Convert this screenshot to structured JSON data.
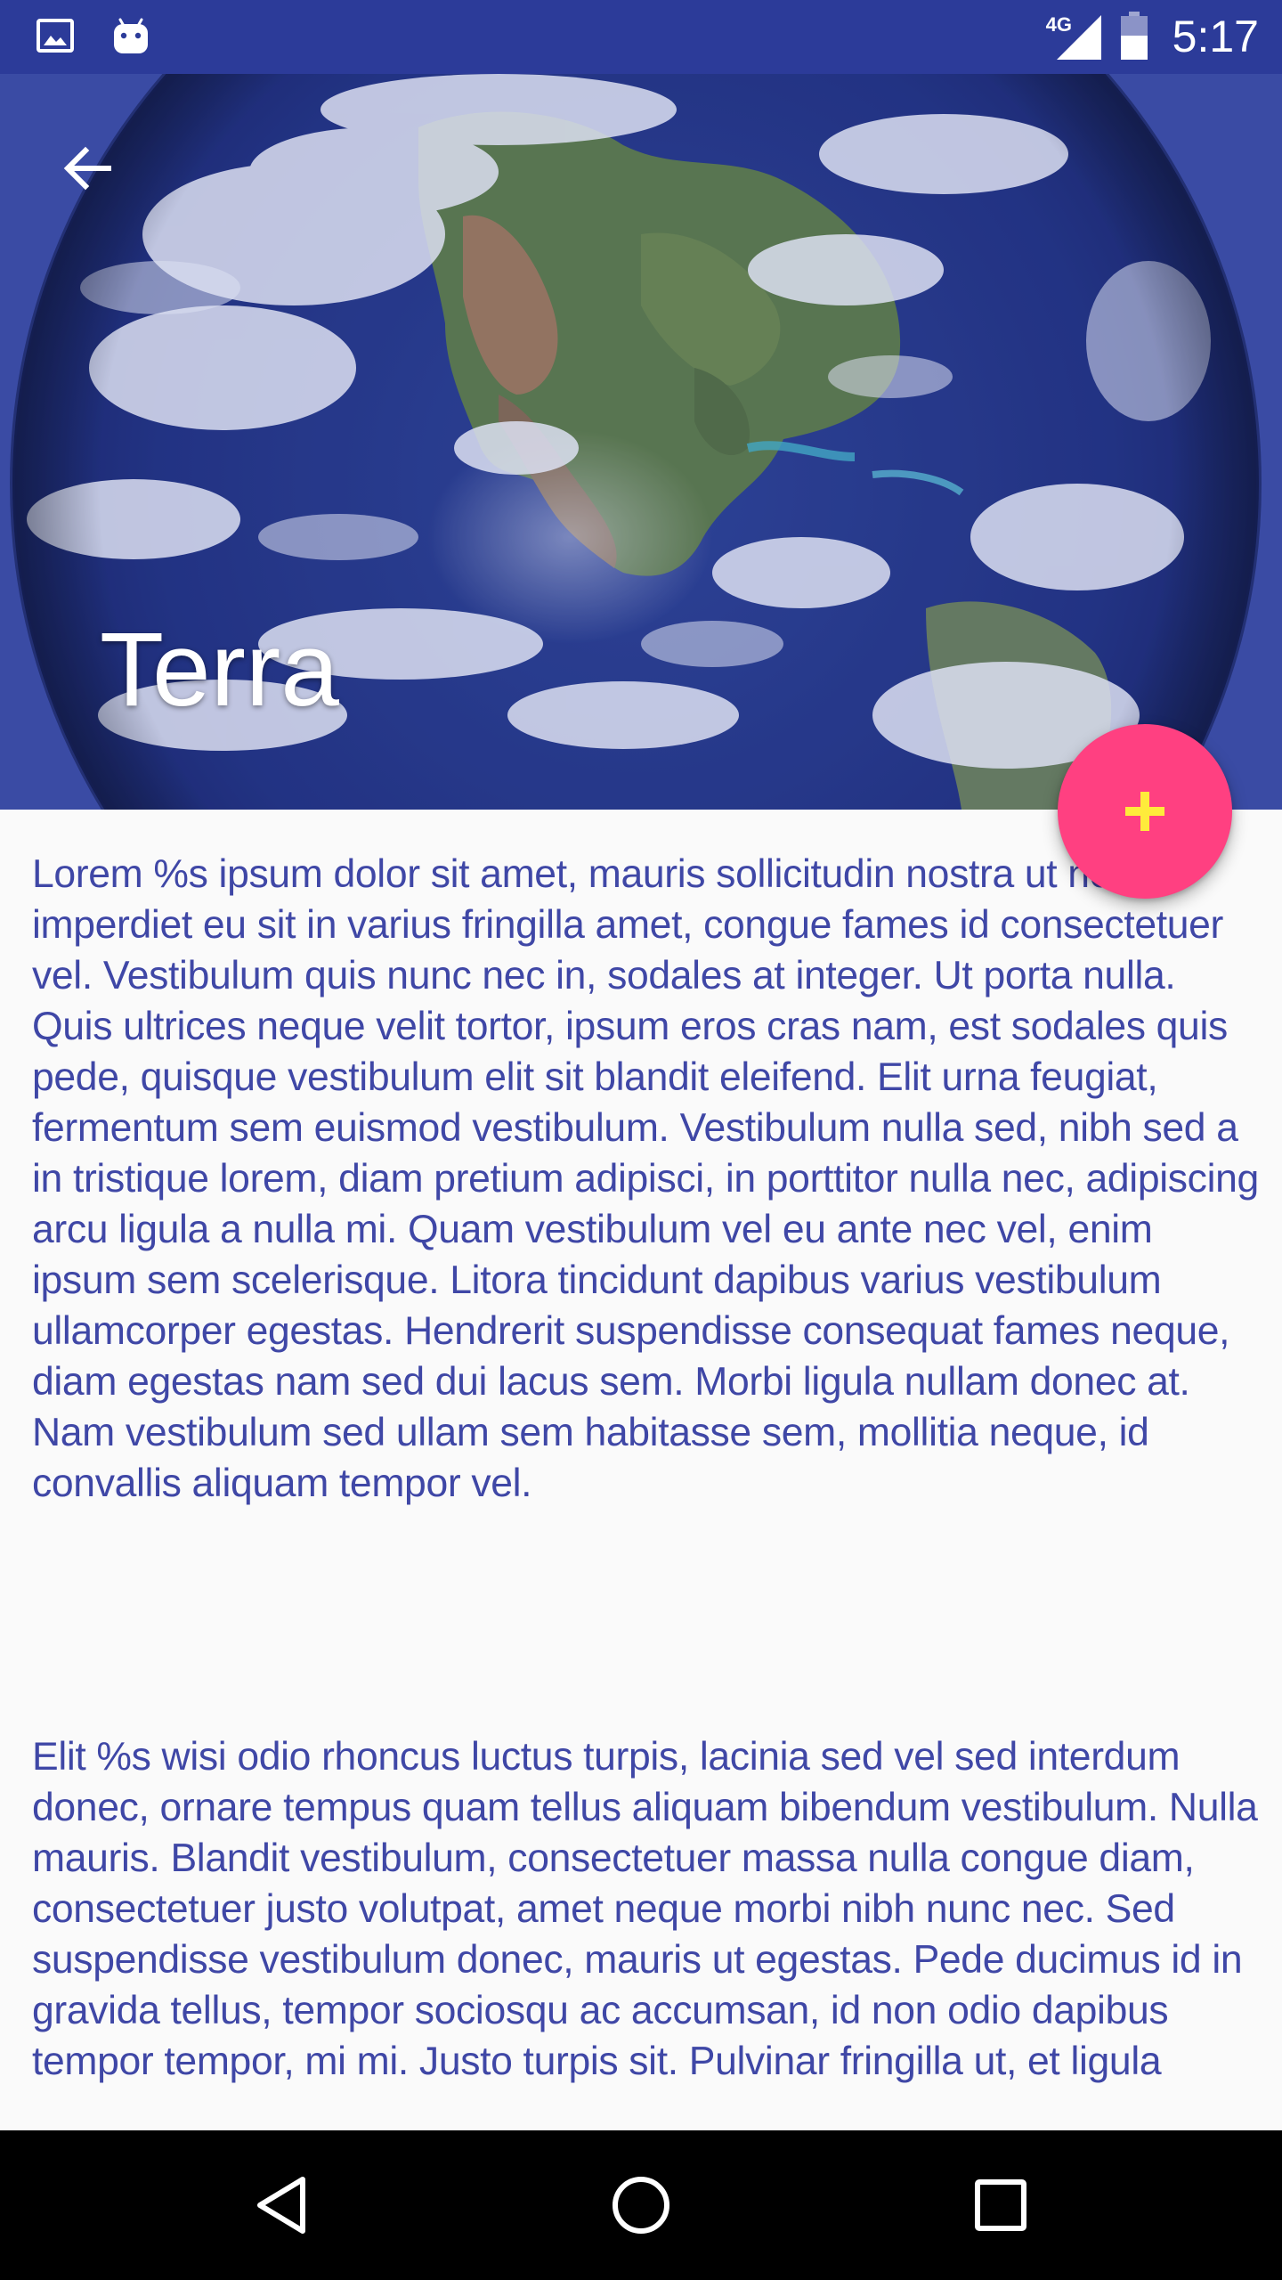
{
  "status_bar": {
    "network_type": "4G",
    "time": "5:17",
    "icons": [
      "gallery-icon",
      "android-icon",
      "signal-icon",
      "battery-icon"
    ]
  },
  "header": {
    "title": "Terra",
    "back_icon": "arrow-back-icon",
    "image": "earth-globe"
  },
  "fab": {
    "icon": "plus-icon",
    "background_color": "#ff4081",
    "icon_color": "#ffeb3b"
  },
  "content": {
    "paragraphs": [
      "Lorem %s ipsum dolor sit amet, mauris sollicitudin nostra ut nec, imperdiet eu sit in varius fringilla amet, congue fames id consectetuer vel. Vestibulum quis nunc nec in, sodales at integer. Ut porta nulla. Quis ultrices neque velit tortor, ipsum eros cras nam, est sodales quis pede, quisque vestibulum elit sit blandit eleifend. Elit urna feugiat, fermentum sem euismod vestibulum. Vestibulum nulla sed, nibh sed a in tristique lorem, diam pretium adipisci, in porttitor nulla nec, adipiscing arcu ligula a nulla mi. Quam vestibulum vel eu ante nec vel, enim ipsum sem scelerisque. Litora tincidunt dapibus varius vestibulum ullamcorper egestas. Hendrerit suspendisse consequat fames neque, diam egestas nam sed dui lacus sem. Morbi ligula nullam donec at. Nam vestibulum sed ullam sem habitasse sem, mollitia neque, id convallis aliquam tempor vel.",
      "Elit %s wisi odio rhoncus luctus turpis, lacinia sed vel sed interdum donec, ornare tempus quam tellus aliquam bibendum vestibulum. Nulla mauris. Blandit vestibulum, consectetuer massa nulla congue diam, consectetuer justo volutpat, amet neque morbi nibh nunc nec. Sed suspendisse vestibulum donec, mauris ut egestas. Pede ducimus id in gravida tellus, tempor sociosqu ac accumsan, id non odio dapibus tempor tempor, mi mi. Justo turpis sit. Pulvinar fringilla ut, et ligula"
    ],
    "text_color": "#3f47a6"
  },
  "navigation_bar": {
    "buttons": [
      "nav-back-icon",
      "nav-home-icon",
      "nav-recents-icon"
    ]
  },
  "colors": {
    "primary_dark": "#2c3b99",
    "accent": "#ff4081",
    "background": "#fafafa"
  }
}
